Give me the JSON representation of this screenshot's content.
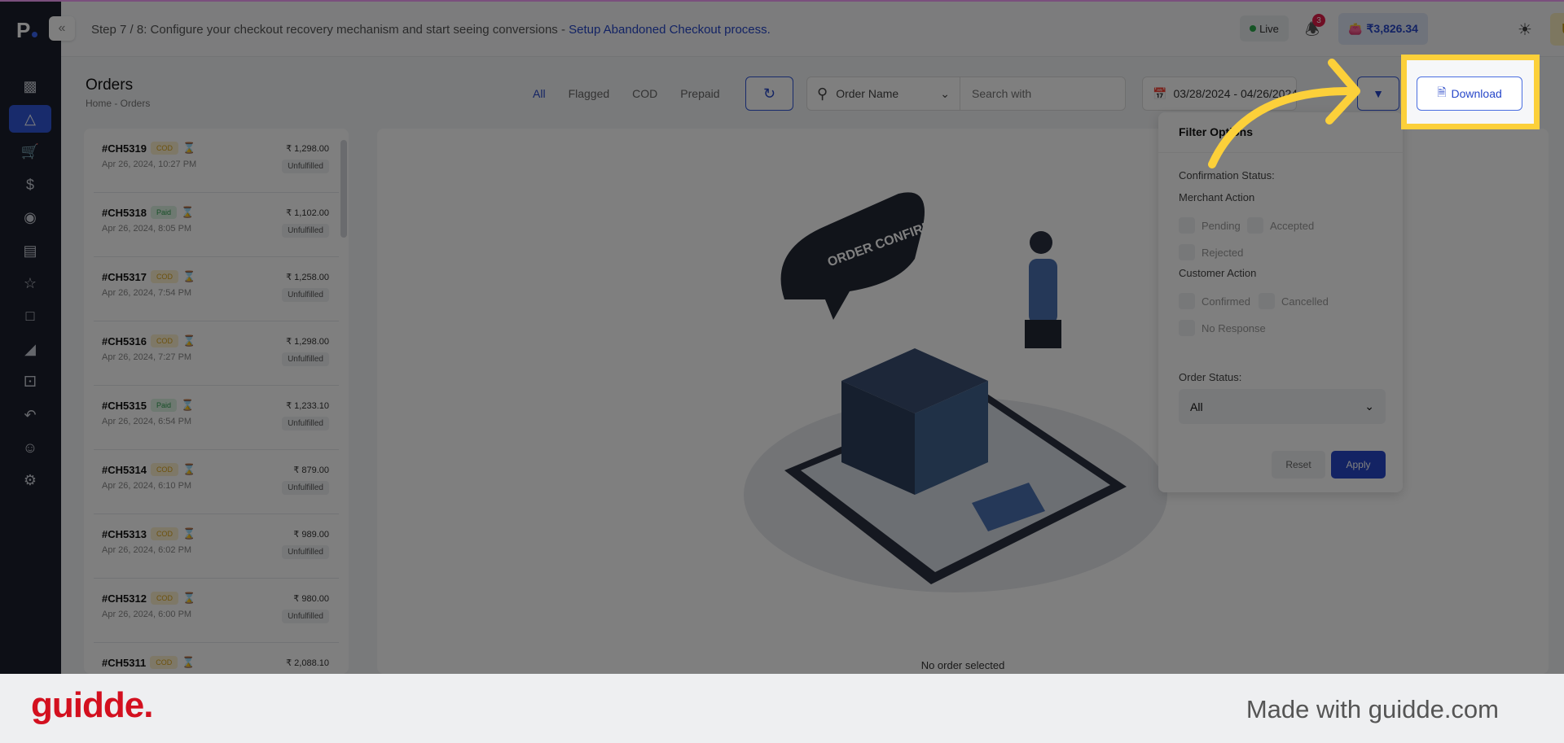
{
  "app": {
    "logo": "P"
  },
  "sidebar": {
    "icons": [
      "bar-chart-icon",
      "package-icon",
      "cart-icon",
      "dollar-icon",
      "location-icon",
      "clipboard-icon",
      "star-icon",
      "chat-icon",
      "megaphone-icon",
      "bell-alert-icon",
      "return-icon",
      "bot-icon",
      "gear-icon"
    ],
    "active": 1
  },
  "topbar": {
    "step_text": "Step 7 / 8: Configure your checkout recovery mechanism and start seeing conversions - ",
    "step_link": "Setup Abandoned Checkout process.",
    "live": "Live",
    "notifications": "3",
    "wallet": "₹3,826.34",
    "avatar": "U"
  },
  "page": {
    "title": "Orders",
    "breadcrumb": "Home - Orders",
    "tabs": [
      "All",
      "Flagged",
      "COD",
      "Prepaid"
    ],
    "active_tab": "All"
  },
  "search": {
    "field": "Order Name",
    "placeholder": "Search with"
  },
  "date_range": "03/28/2024 - 04/26/2024",
  "download_label": "Download",
  "orders": [
    {
      "id": "#CH5319",
      "pay": "COD",
      "date": "Apr 26, 2024, 10:27 PM",
      "amount": "₹ 1,298.00",
      "status": "Unfulfilled"
    },
    {
      "id": "#CH5318",
      "pay": "Paid",
      "date": "Apr 26, 2024, 8:05 PM",
      "amount": "₹ 1,102.00",
      "status": "Unfulfilled"
    },
    {
      "id": "#CH5317",
      "pay": "COD",
      "date": "Apr 26, 2024, 7:54 PM",
      "amount": "₹ 1,258.00",
      "status": "Unfulfilled"
    },
    {
      "id": "#CH5316",
      "pay": "COD",
      "date": "Apr 26, 2024, 7:27 PM",
      "amount": "₹ 1,298.00",
      "status": "Unfulfilled"
    },
    {
      "id": "#CH5315",
      "pay": "Paid",
      "date": "Apr 26, 2024, 6:54 PM",
      "amount": "₹ 1,233.10",
      "status": "Unfulfilled"
    },
    {
      "id": "#CH5314",
      "pay": "COD",
      "date": "Apr 26, 2024, 6:10 PM",
      "amount": "₹ 879.00",
      "status": "Unfulfilled"
    },
    {
      "id": "#CH5313",
      "pay": "COD",
      "date": "Apr 26, 2024, 6:02 PM",
      "amount": "₹ 989.00",
      "status": "Unfulfilled"
    },
    {
      "id": "#CH5312",
      "pay": "COD",
      "date": "Apr 26, 2024, 6:00 PM",
      "amount": "₹ 980.00",
      "status": "Unfulfilled"
    },
    {
      "id": "#CH5311",
      "pay": "COD",
      "date": "",
      "amount": "₹ 2,088.10",
      "status": ""
    }
  ],
  "main": {
    "empty_text": "No order selected",
    "illustration_text": "ORDER CONFIRMED"
  },
  "filter": {
    "title": "Filter Options",
    "confirmation": "Confirmation Status:",
    "merchant": "Merchant Action",
    "merchant_opts": [
      "Pending",
      "Accepted",
      "Rejected"
    ],
    "customer": "Customer Action",
    "customer_opts": [
      "Confirmed",
      "Cancelled",
      "No Response"
    ],
    "order_status_label": "Order Status:",
    "order_status": "All",
    "reset": "Reset",
    "apply": "Apply"
  },
  "footer": {
    "logo": "guidde.",
    "made_with": "Made with guidde.com"
  },
  "colors": {
    "accent": "#2747c9",
    "highlight": "#fcd03a",
    "brand_red": "#d3101f"
  }
}
